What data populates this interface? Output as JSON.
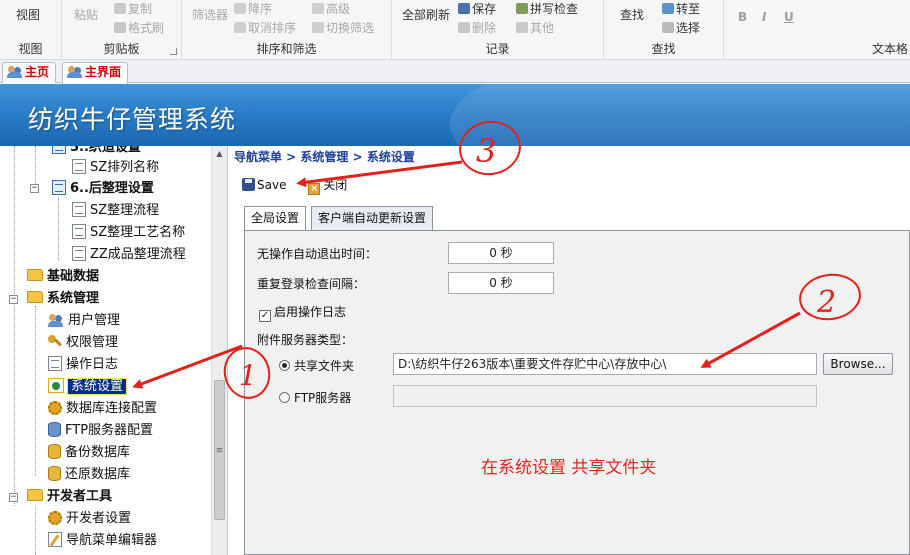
{
  "ribbon": {
    "view": {
      "label": "视图",
      "group": "视图"
    },
    "clipboard": {
      "paste": "粘贴",
      "copy": "复制",
      "format_painter": "格式刷",
      "group": "剪贴板"
    },
    "sort_filter": {
      "filter": "筛选器",
      "descending": "降序",
      "clear_sort": "取消排序",
      "advanced": "高级",
      "toggle_filter": "切换筛选",
      "group": "排序和筛选"
    },
    "records": {
      "refresh_all": "全部刷新",
      "save": "保存",
      "delete": "删除",
      "spelling": "拼写检查",
      "other": "其他",
      "group": "记录"
    },
    "find": {
      "find": "查找",
      "goto": "转至",
      "select": "选择",
      "group": "查找"
    },
    "text_format": {
      "bold": "B",
      "italic": "I",
      "underline": "U",
      "group": "文本格"
    }
  },
  "doc_tabs": [
    {
      "label": "主页"
    },
    {
      "label": "主界面"
    }
  ],
  "banner": {
    "title": "纺织牛仔管理系统"
  },
  "tree": {
    "n0": "5..织造设置",
    "n1": "SZ排列名称",
    "n2": "6..后整理设置",
    "n3": "SZ整理流程",
    "n4": "SZ整理工艺名称",
    "n5": "ZZ成品整理流程",
    "n6": "基础数据",
    "n7": "系统管理",
    "n8": "用户管理",
    "n9": "权限管理",
    "n10": "操作日志",
    "n11": "系统设置",
    "n12": "数据库连接配置",
    "n13": "FTP服务器配置",
    "n14": "备份数据库",
    "n15": "还原数据库",
    "n16": "开发者工具",
    "n17": "开发者设置",
    "n18": "导航菜单编辑器"
  },
  "content": {
    "breadcrumb": "导航菜单 > 系统管理 > 系统设置",
    "save": "Save",
    "close": "关闭",
    "tabs": [
      "全局设置",
      "客户端自动更新设置"
    ],
    "auto_logout_label": "无操作自动退出时间：",
    "auto_logout_value": "0 秒",
    "relogin_label": "重复登录检查间隔：",
    "relogin_value": "0 秒",
    "enable_log_label": "启用操作日志",
    "enable_log_checked": true,
    "server_type_label": "附件服务器类型：",
    "shared_folder_label": "共享文件夹",
    "shared_folder_path": "D:\\纺织牛仔263版本\\重要文件存贮中心\\存放中心\\",
    "browse": "Browse...",
    "ftp_label": "FTP服务器",
    "note": "在系统设置  共享文件夹"
  },
  "annotations": {
    "one": "1",
    "two": "2",
    "three": "3",
    "color": "#e4201a"
  }
}
